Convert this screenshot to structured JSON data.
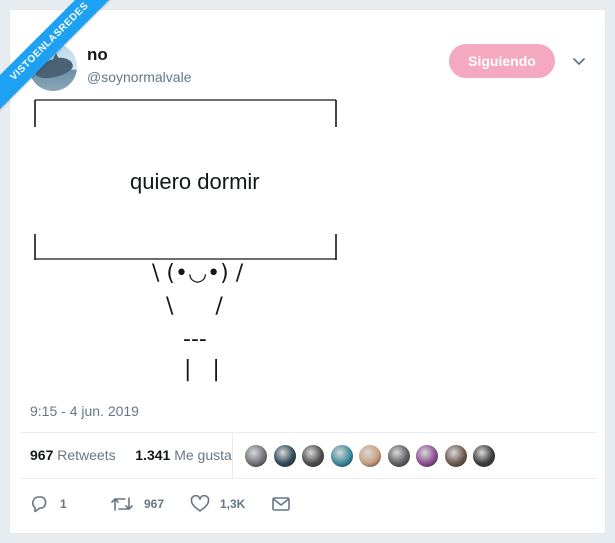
{
  "watermark": {
    "text": "VISTOENLASREDES"
  },
  "tweet": {
    "display_name": "no",
    "handle": "@soynormalvale",
    "follow_label": "Siguiendo",
    "text": {
      "box_text": "quiero dormir",
      "kaomoji_line1": "\\ (•◡•) /",
      "kaomoji_line2": "\\      /",
      "kaomoji_line3": "---",
      "kaomoji_line4": "|   |"
    },
    "timestamp": "9:15 - 4 jun. 2019"
  },
  "stats": {
    "retweets_count": "967",
    "retweets_label": "Retweets",
    "likes_count": "1.341",
    "likes_label": "Me gusta"
  },
  "likers": {
    "avatar_colors": [
      "#6f7478",
      "#2f4a5a",
      "#4e4e4e",
      "#3c8a9c",
      "#c9a07f",
      "#5e6266",
      "#8c4f94",
      "#6b5a4c",
      "#3d3d3d"
    ]
  },
  "actions": {
    "reply_count": "1",
    "retweet_count": "967",
    "like_count": "1,3K"
  },
  "colors": {
    "accent_blue": "#1da1f2",
    "follow_pink": "#f4a9c0",
    "muted_text": "#657786"
  }
}
